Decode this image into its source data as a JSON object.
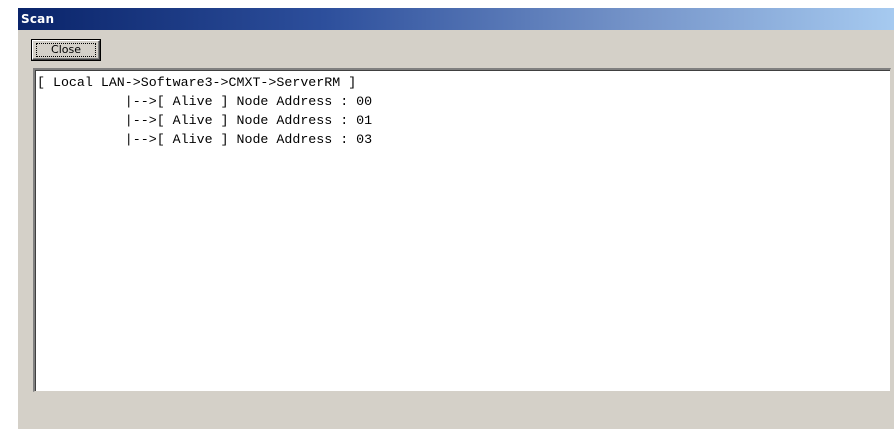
{
  "window": {
    "title": "Scan"
  },
  "toolbar": {
    "close_label": "Close"
  },
  "output": {
    "lines": [
      "[ Local LAN->Software3->CMXT->ServerRM ]",
      "           |-->[ Alive ] Node Address : 00",
      "           |-->[ Alive ] Node Address : 01",
      "           |-->[ Alive ] Node Address : 03"
    ]
  },
  "colors": {
    "titlebar_start": "#0a246a",
    "titlebar_end": "#a6caf0",
    "window_face": "#d4d0c8",
    "output_background": "#ffffff"
  }
}
